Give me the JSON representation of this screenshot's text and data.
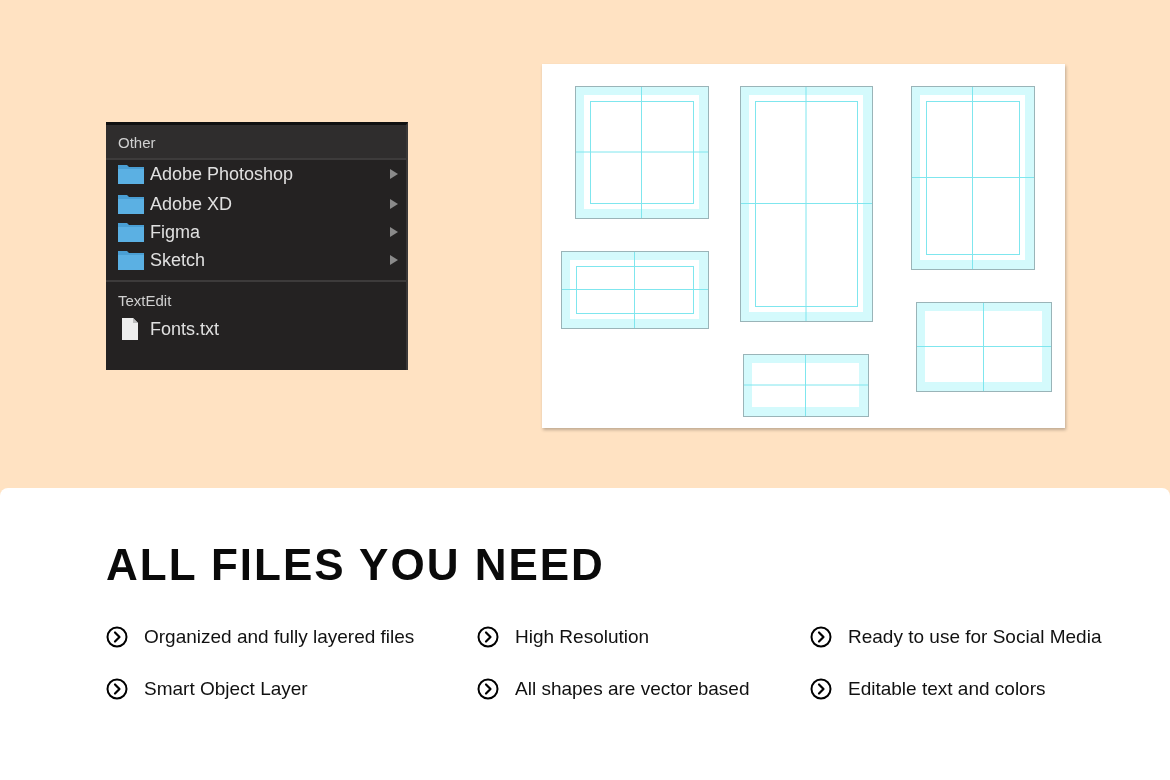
{
  "menu": {
    "sections": [
      {
        "title": "Other",
        "items": [
          {
            "label": "Adobe Photoshop",
            "kind": "folder",
            "has_submenu": true
          },
          {
            "label": "Adobe XD",
            "kind": "folder",
            "has_submenu": true
          },
          {
            "label": "Figma",
            "kind": "folder",
            "has_submenu": true
          },
          {
            "label": "Sketch",
            "kind": "folder",
            "has_submenu": true
          }
        ]
      },
      {
        "title": "TextEdit",
        "items": [
          {
            "label": "Fonts.txt",
            "kind": "file",
            "has_submenu": false
          }
        ]
      }
    ]
  },
  "heading": "ALL FILES YOU NEED",
  "features": [
    "Organized and fully layered files",
    "High Resolution",
    "Ready to use for Social Media",
    "Smart Object Layer",
    "All shapes are vector based",
    "Editable text and colors"
  ]
}
